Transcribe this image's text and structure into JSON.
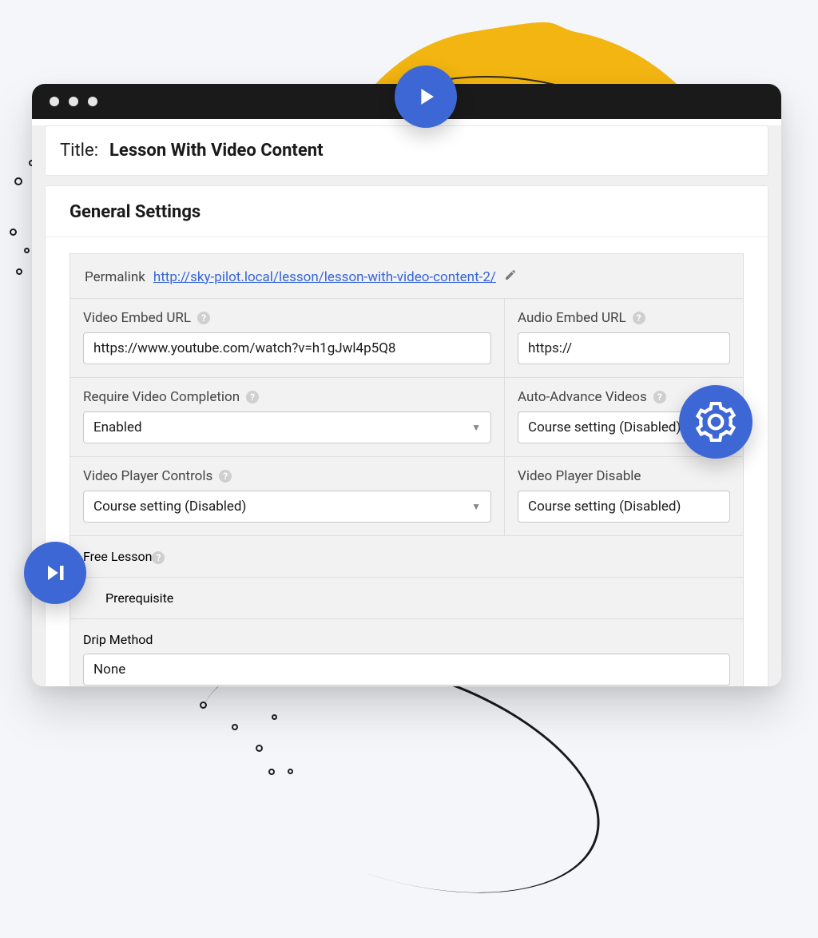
{
  "colors": {
    "accent": "#3e67d6",
    "accentYellow": "#f3b511"
  },
  "title_row": {
    "label": "Title:",
    "value": "Lesson With Video Content"
  },
  "panel_heading": "General Settings",
  "permalink": {
    "label": "Permalink",
    "url": "http://sky-pilot.local/lesson/lesson-with-video-content-2/"
  },
  "fields": {
    "video_embed": {
      "label": "Video Embed URL",
      "value": "https://www.youtube.com/watch?v=h1gJwl4p5Q8"
    },
    "audio_embed": {
      "label": "Audio Embed URL",
      "value": "https://"
    },
    "require_completion": {
      "label": "Require Video Completion",
      "value": "Enabled"
    },
    "auto_advance": {
      "label": "Auto-Advance Videos",
      "value": "Course setting (Disabled)"
    },
    "player_controls": {
      "label": "Video Player Controls",
      "value": "Course setting (Disabled)"
    },
    "player_disable": {
      "label": "Video Player Disable",
      "value": "Course setting (Disabled)"
    },
    "free_lesson": {
      "label": "Free Lesson"
    },
    "prerequisite": {
      "label": "Prerequisite"
    },
    "drip": {
      "label": "Drip Method",
      "value": "None"
    }
  },
  "badges": {
    "play": "play-icon",
    "skip": "skip-next-icon",
    "gear": "gear-icon"
  }
}
